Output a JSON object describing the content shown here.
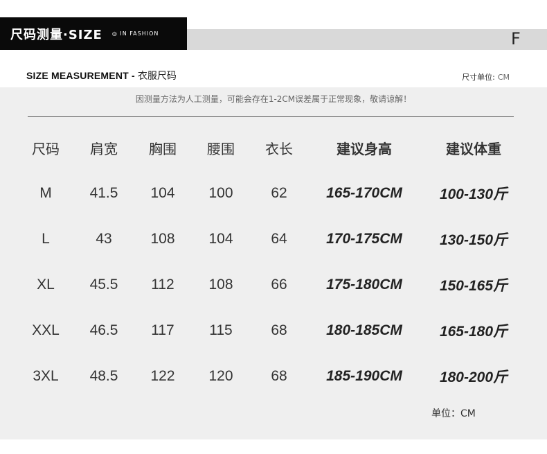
{
  "header": {
    "title": "尺码测量·SIZE",
    "subtitle": "◎ IN FASHION",
    "size_letter": "F"
  },
  "subheader": {
    "en": "SIZE MEASUREMENT -",
    "cn": "衣服尺码",
    "unit_label": "尺寸单位:",
    "unit_value": "CM"
  },
  "note": "因测量方法为人工测量，可能会存在1-2CM误差属于正常现象，敬请谅解！",
  "table": {
    "headers": [
      "尺码",
      "肩宽",
      "胸围",
      "腰围",
      "衣长",
      "建议身高",
      "建议体重"
    ],
    "rows": [
      [
        "M",
        "41.5",
        "104",
        "100",
        "62",
        "165-170CM",
        "100-130斤"
      ],
      [
        "L",
        "43",
        "108",
        "104",
        "64",
        "170-175CM",
        "130-150斤"
      ],
      [
        "XL",
        "45.5",
        "112",
        "108",
        "66",
        "175-180CM",
        "150-165斤"
      ],
      [
        "XXL",
        "46.5",
        "117",
        "115",
        "68",
        "180-185CM",
        "165-180斤"
      ],
      [
        "3XL",
        "48.5",
        "122",
        "120",
        "68",
        "185-190CM",
        "180-200斤"
      ]
    ]
  },
  "footer": {
    "unit": "单位：CM"
  }
}
